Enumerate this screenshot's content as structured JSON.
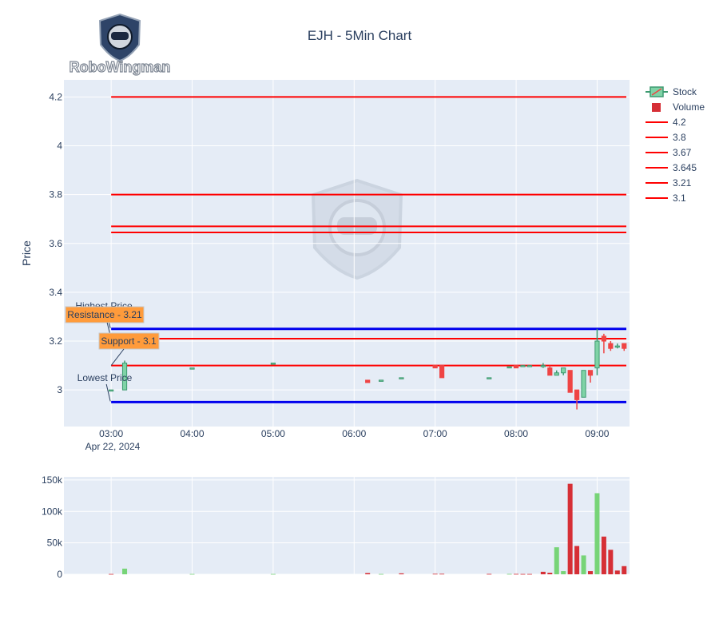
{
  "title": "EJH - 5Min Chart",
  "logo_text": "RoboWingman",
  "colors": {
    "up": "#3d9a70",
    "up_fill": "#7fd3a6",
    "down": "#ef4444",
    "vol_up": "#77d477",
    "vol_down": "#d62f36",
    "level": "#ff0000",
    "blue": "#0000ee",
    "plot_bg": "#e5ecf6",
    "annot_bg": "#ff9b3b"
  },
  "chart_data": [
    {
      "type": "candlestick",
      "ylabel": "Price",
      "xlabel": "",
      "ylim": [
        2.85,
        4.27
      ],
      "y_ticks": [
        3,
        3.2,
        3.4,
        3.6,
        3.8,
        4,
        4.2
      ],
      "x_ticks": [
        "03:00",
        "04:00",
        "05:00",
        "06:00",
        "07:00",
        "08:00",
        "09:00"
      ],
      "x_date_label": "Apr 22, 2024",
      "grid": true,
      "legend_position": "right",
      "legend": [
        "Stock",
        "Volume",
        "4.2",
        "3.8",
        "3.67",
        "3.645",
        "3.21",
        "3.1"
      ],
      "levels": [
        4.2,
        3.8,
        3.67,
        3.645,
        3.21,
        3.1
      ],
      "highest_price": 3.25,
      "lowest_price": 2.95,
      "annotations": {
        "highest": "Highest Price",
        "resistance": "Resistance - 3.21",
        "support": "Support - 3.1",
        "lowest": "Lowest Price"
      },
      "candles": [
        {
          "t": "03:00",
          "o": 3.0,
          "h": 3.0,
          "l": 3.0,
          "c": 3.0
        },
        {
          "t": "03:10",
          "o": 3.0,
          "h": 3.12,
          "l": 3.0,
          "c": 3.11
        },
        {
          "t": "04:00",
          "o": 3.09,
          "h": 3.09,
          "l": 3.085,
          "c": 3.09
        },
        {
          "t": "05:00",
          "o": 3.11,
          "h": 3.11,
          "l": 3.11,
          "c": 3.11
        },
        {
          "t": "06:10",
          "o": 3.04,
          "h": 3.04,
          "l": 3.03,
          "c": 3.03
        },
        {
          "t": "06:20",
          "o": 3.04,
          "h": 3.04,
          "l": 3.04,
          "c": 3.04
        },
        {
          "t": "06:35",
          "o": 3.05,
          "h": 3.05,
          "l": 3.05,
          "c": 3.05
        },
        {
          "t": "07:00",
          "o": 3.1,
          "h": 3.1,
          "l": 3.09,
          "c": 3.09
        },
        {
          "t": "07:05",
          "o": 3.1,
          "h": 3.1,
          "l": 3.05,
          "c": 3.05
        },
        {
          "t": "07:40",
          "o": 3.05,
          "h": 3.05,
          "l": 3.05,
          "c": 3.05
        },
        {
          "t": "07:55",
          "o": 3.09,
          "h": 3.095,
          "l": 3.09,
          "c": 3.095
        },
        {
          "t": "08:00",
          "o": 3.1,
          "h": 3.1,
          "l": 3.09,
          "c": 3.09
        },
        {
          "t": "08:05",
          "o": 3.1,
          "h": 3.1,
          "l": 3.1,
          "c": 3.1
        },
        {
          "t": "08:10",
          "o": 3.1,
          "h": 3.1,
          "l": 3.1,
          "c": 3.1
        },
        {
          "t": "08:20",
          "o": 3.1,
          "h": 3.11,
          "l": 3.09,
          "c": 3.1
        },
        {
          "t": "08:25",
          "o": 3.09,
          "h": 3.1,
          "l": 3.06,
          "c": 3.06
        },
        {
          "t": "08:30",
          "o": 3.06,
          "h": 3.08,
          "l": 3.06,
          "c": 3.07
        },
        {
          "t": "08:35",
          "o": 3.07,
          "h": 3.09,
          "l": 3.06,
          "c": 3.09
        },
        {
          "t": "08:40",
          "o": 3.08,
          "h": 3.08,
          "l": 2.99,
          "c": 2.99
        },
        {
          "t": "08:45",
          "o": 3.0,
          "h": 3.0,
          "l": 2.92,
          "c": 2.96
        },
        {
          "t": "08:50",
          "o": 2.97,
          "h": 3.08,
          "l": 2.97,
          "c": 3.08
        },
        {
          "t": "08:55",
          "o": 3.08,
          "h": 3.08,
          "l": 3.03,
          "c": 3.06
        },
        {
          "t": "09:00",
          "o": 3.09,
          "h": 3.25,
          "l": 3.06,
          "c": 3.2
        },
        {
          "t": "09:05",
          "o": 3.22,
          "h": 3.23,
          "l": 3.15,
          "c": 3.2
        },
        {
          "t": "09:10",
          "o": 3.19,
          "h": 3.2,
          "l": 3.16,
          "c": 3.17
        },
        {
          "t": "09:15",
          "o": 3.18,
          "h": 3.19,
          "l": 3.17,
          "c": 3.18
        },
        {
          "t": "09:20",
          "o": 3.19,
          "h": 3.19,
          "l": 3.16,
          "c": 3.17
        }
      ]
    },
    {
      "type": "bar",
      "ylim": [
        0,
        155000
      ],
      "y_ticks": [
        0,
        50000,
        100000,
        150000
      ],
      "y_tick_labels": [
        "0",
        "50k",
        "100k",
        "150k"
      ],
      "volumes": [
        {
          "t": "03:00",
          "v": 500,
          "up": false
        },
        {
          "t": "03:10",
          "v": 9000,
          "up": true
        },
        {
          "t": "04:00",
          "v": 500,
          "up": true
        },
        {
          "t": "05:00",
          "v": 500,
          "up": true
        },
        {
          "t": "06:10",
          "v": 2000,
          "up": false
        },
        {
          "t": "06:20",
          "v": 500,
          "up": true
        },
        {
          "t": "06:35",
          "v": 1500,
          "up": false
        },
        {
          "t": "07:00",
          "v": 800,
          "up": false
        },
        {
          "t": "07:05",
          "v": 800,
          "up": false
        },
        {
          "t": "07:40",
          "v": 600,
          "up": false
        },
        {
          "t": "07:55",
          "v": 600,
          "up": true
        },
        {
          "t": "08:00",
          "v": 600,
          "up": false
        },
        {
          "t": "08:05",
          "v": 500,
          "up": false
        },
        {
          "t": "08:10",
          "v": 500,
          "up": false
        },
        {
          "t": "08:20",
          "v": 4000,
          "up": false
        },
        {
          "t": "08:25",
          "v": 2500,
          "up": false
        },
        {
          "t": "08:30",
          "v": 43000,
          "up": true
        },
        {
          "t": "08:35",
          "v": 5000,
          "up": true
        },
        {
          "t": "08:40",
          "v": 144000,
          "up": false
        },
        {
          "t": "08:45",
          "v": 45000,
          "up": false
        },
        {
          "t": "08:50",
          "v": 30000,
          "up": true
        },
        {
          "t": "08:55",
          "v": 5000,
          "up": false
        },
        {
          "t": "09:00",
          "v": 129000,
          "up": true
        },
        {
          "t": "09:05",
          "v": 60000,
          "up": false
        },
        {
          "t": "09:10",
          "v": 39000,
          "up": false
        },
        {
          "t": "09:15",
          "v": 6000,
          "up": false
        },
        {
          "t": "09:20",
          "v": 13000,
          "up": false
        }
      ]
    }
  ]
}
